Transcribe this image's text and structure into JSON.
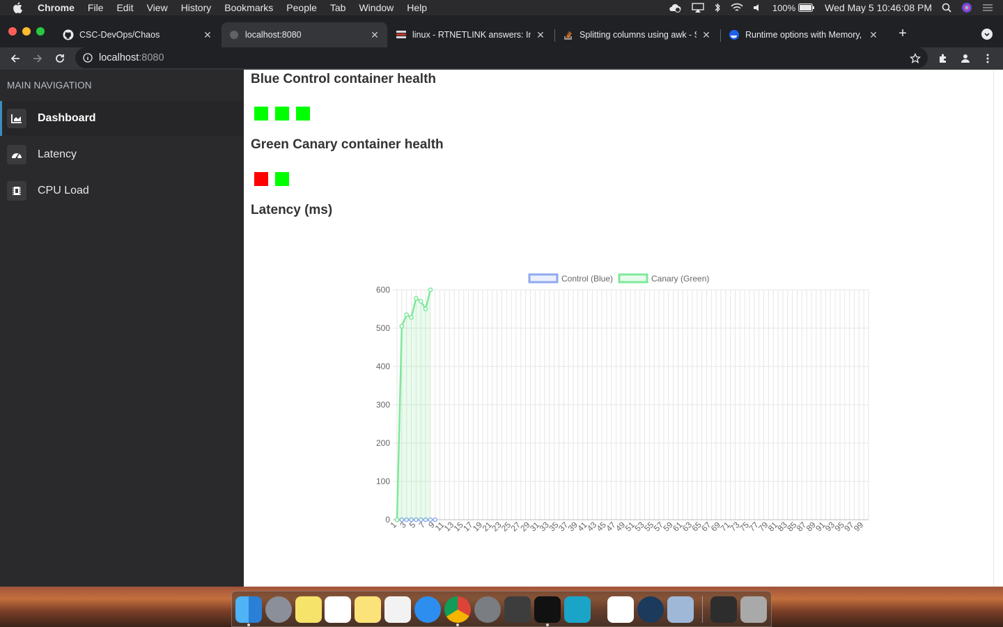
{
  "menubar": {
    "app": "Chrome",
    "items": [
      "File",
      "Edit",
      "View",
      "History",
      "Bookmarks",
      "People",
      "Tab",
      "Window",
      "Help"
    ],
    "battery": "100%",
    "clock": "Wed May 5  10:46:08 PM"
  },
  "tabs": [
    {
      "title": "CSC-DevOps/Chaos",
      "icon": "github-icon"
    },
    {
      "title": "localhost:8080",
      "icon": "globe-icon"
    },
    {
      "title": "linux - RTNETLINK answers: In",
      "icon": "stackexchange-icon"
    },
    {
      "title": "Splitting columns using awk - S",
      "icon": "stackoverflow-icon"
    },
    {
      "title": "Runtime options with Memory,",
      "icon": "docker-icon"
    }
  ],
  "toolbar": {
    "url_host": "localhost",
    "url_port": ":8080"
  },
  "sidebar": {
    "header": "MAIN NAVIGATION",
    "items": [
      {
        "label": "Dashboard",
        "icon": "chart-icon",
        "active": true
      },
      {
        "label": "Latency",
        "icon": "gauge-icon",
        "active": false
      },
      {
        "label": "CPU Load",
        "icon": "cpu-icon",
        "active": false
      }
    ]
  },
  "main": {
    "blue_heading": "Blue Control container health",
    "blue_health": [
      "#00ff00",
      "#00ff00",
      "#00ff00"
    ],
    "green_heading": "Green Canary container health",
    "green_health": [
      "#ff0000",
      "#00ff00"
    ],
    "latency_heading": "Latency (ms)"
  },
  "chart_data": {
    "type": "line",
    "x_start": 1,
    "x_end": 100,
    "ylim": [
      0,
      600
    ],
    "yticks": [
      0,
      100,
      200,
      300,
      400,
      500,
      600
    ],
    "series": [
      {
        "name": "Control (Blue)",
        "color": "#8ea9ef",
        "values": [
          0,
          0,
          0,
          0,
          0,
          0,
          0,
          0,
          0
        ]
      },
      {
        "name": "Canary (Green)",
        "color": "#7fe89a",
        "values": [
          0,
          505,
          535,
          528,
          578,
          570,
          550,
          600
        ]
      }
    ]
  }
}
